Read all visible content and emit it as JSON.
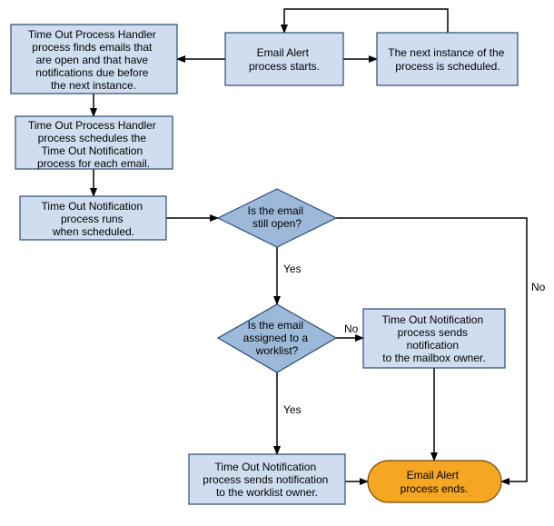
{
  "nodes": {
    "start": {
      "l1": "Email Alert",
      "l2": "process starts."
    },
    "schedule": {
      "l1": "The next instance of the",
      "l2": "process is scheduled."
    },
    "find": {
      "l1": "Time Out Process Handler",
      "l2": "process finds emails that",
      "l3": "are open and that have",
      "l4": "notifications due before",
      "l5": "the next instance."
    },
    "scheduleeach": {
      "l1": "Time Out Process Handler",
      "l2": "process schedules the",
      "l3": "Time Out Notification",
      "l4": "process for each email."
    },
    "runs": {
      "l1": "Time Out Notification",
      "l2": "process runs",
      "l3": "when scheduled."
    },
    "d1": {
      "l1": "Is the email",
      "l2": "still open?"
    },
    "d2": {
      "l1": "Is the email",
      "l2": "assigned to a",
      "l3": "worklist?"
    },
    "mailbox": {
      "l1": "Time Out Notification",
      "l2": "process sends",
      "l3": "notification",
      "l4": "to the mailbox owner."
    },
    "worklist": {
      "l1": "Time Out Notification",
      "l2": "process sends notification",
      "l3": "to the worklist owner."
    },
    "end": {
      "l1": "Email Alert",
      "l2": "process ends."
    }
  },
  "labels": {
    "yes": "Yes",
    "no": "No"
  },
  "chart_data": {
    "type": "flowchart",
    "title": "Email Alert time-out notification flow",
    "nodes": [
      {
        "id": "start",
        "type": "process",
        "text": "Email Alert process starts."
      },
      {
        "id": "schedule",
        "type": "process",
        "text": "The next instance of the process is scheduled."
      },
      {
        "id": "find",
        "type": "process",
        "text": "Time Out Process Handler process finds emails that are open and that have notifications due before the next instance."
      },
      {
        "id": "scheduleeach",
        "type": "process",
        "text": "Time Out Process Handler process schedules the Time Out Notification process for each email."
      },
      {
        "id": "runs",
        "type": "process",
        "text": "Time Out Notification process runs when scheduled."
      },
      {
        "id": "d1",
        "type": "decision",
        "text": "Is the email still open?"
      },
      {
        "id": "d2",
        "type": "decision",
        "text": "Is the email assigned to a worklist?"
      },
      {
        "id": "mailbox",
        "type": "process",
        "text": "Time Out Notification process sends notification to the mailbox owner."
      },
      {
        "id": "worklist",
        "type": "process",
        "text": "Time Out Notification process sends notification to the worklist owner."
      },
      {
        "id": "end",
        "type": "terminator",
        "text": "Email Alert process ends."
      }
    ],
    "edges": [
      {
        "from": "start",
        "to": "schedule",
        "label": ""
      },
      {
        "from": "schedule",
        "to": "start",
        "label": ""
      },
      {
        "from": "start",
        "to": "find",
        "label": ""
      },
      {
        "from": "find",
        "to": "scheduleeach",
        "label": ""
      },
      {
        "from": "scheduleeach",
        "to": "runs",
        "label": ""
      },
      {
        "from": "runs",
        "to": "d1",
        "label": ""
      },
      {
        "from": "d1",
        "to": "d2",
        "label": "Yes"
      },
      {
        "from": "d1",
        "to": "end",
        "label": "No"
      },
      {
        "from": "d2",
        "to": "worklist",
        "label": "Yes"
      },
      {
        "from": "d2",
        "to": "mailbox",
        "label": "No"
      },
      {
        "from": "mailbox",
        "to": "end",
        "label": ""
      },
      {
        "from": "worklist",
        "to": "end",
        "label": ""
      }
    ]
  }
}
